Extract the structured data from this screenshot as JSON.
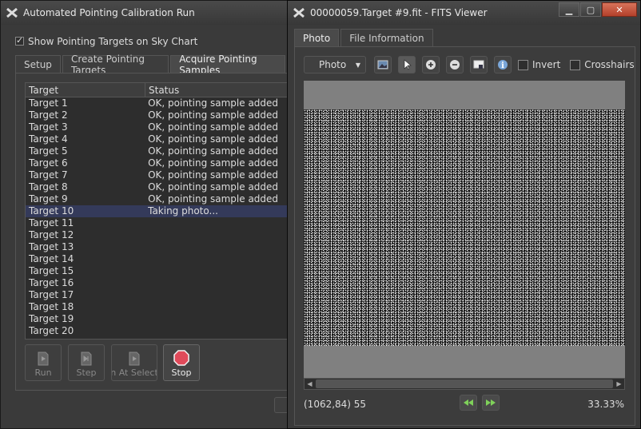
{
  "left_window": {
    "title": "Automated Pointing Calibration Run",
    "show_targets_label": "Show Pointing Targets on Sky Chart",
    "tabs": [
      "Setup",
      "Create Pointing Targets",
      "Acquire Pointing Samples"
    ],
    "table": {
      "headers": [
        "Target",
        "Status"
      ],
      "rows": [
        {
          "target": "Target 1",
          "status": "OK, pointing sample added"
        },
        {
          "target": "Target 2",
          "status": "OK, pointing sample added"
        },
        {
          "target": "Target 3",
          "status": "OK, pointing sample added"
        },
        {
          "target": "Target 4",
          "status": "OK, pointing sample added"
        },
        {
          "target": "Target 5",
          "status": "OK, pointing sample added"
        },
        {
          "target": "Target 6",
          "status": "OK, pointing sample added"
        },
        {
          "target": "Target 7",
          "status": "OK, pointing sample added"
        },
        {
          "target": "Target 8",
          "status": "OK, pointing sample added"
        },
        {
          "target": "Target 9",
          "status": "OK, pointing sample added"
        },
        {
          "target": "Target 10",
          "status": "Taking photo..."
        },
        {
          "target": "Target 11",
          "status": ""
        },
        {
          "target": "Target 12",
          "status": ""
        },
        {
          "target": "Target 13",
          "status": ""
        },
        {
          "target": "Target 14",
          "status": ""
        },
        {
          "target": "Target 15",
          "status": ""
        },
        {
          "target": "Target 16",
          "status": ""
        },
        {
          "target": "Target 17",
          "status": ""
        },
        {
          "target": "Target 18",
          "status": ""
        },
        {
          "target": "Target 19",
          "status": ""
        },
        {
          "target": "Target 20",
          "status": ""
        }
      ]
    },
    "buttons": {
      "run": "Run",
      "step": "Step",
      "run_at_selection": "in At Selecti",
      "stop": "Stop"
    }
  },
  "right_window": {
    "title": "00000059.Target #9.fit - FITS Viewer",
    "tabs": [
      "Photo",
      "File Information"
    ],
    "view_select": "Photo",
    "invert_label": "Invert",
    "crosshairs_label": "Crosshairs",
    "coords": "(1062,84) 55",
    "zoom": "33.33%"
  },
  "colors": {
    "accent_selection": "#343a5a",
    "close_button": "#c0452c",
    "stop_icon": "#e04a5a"
  }
}
